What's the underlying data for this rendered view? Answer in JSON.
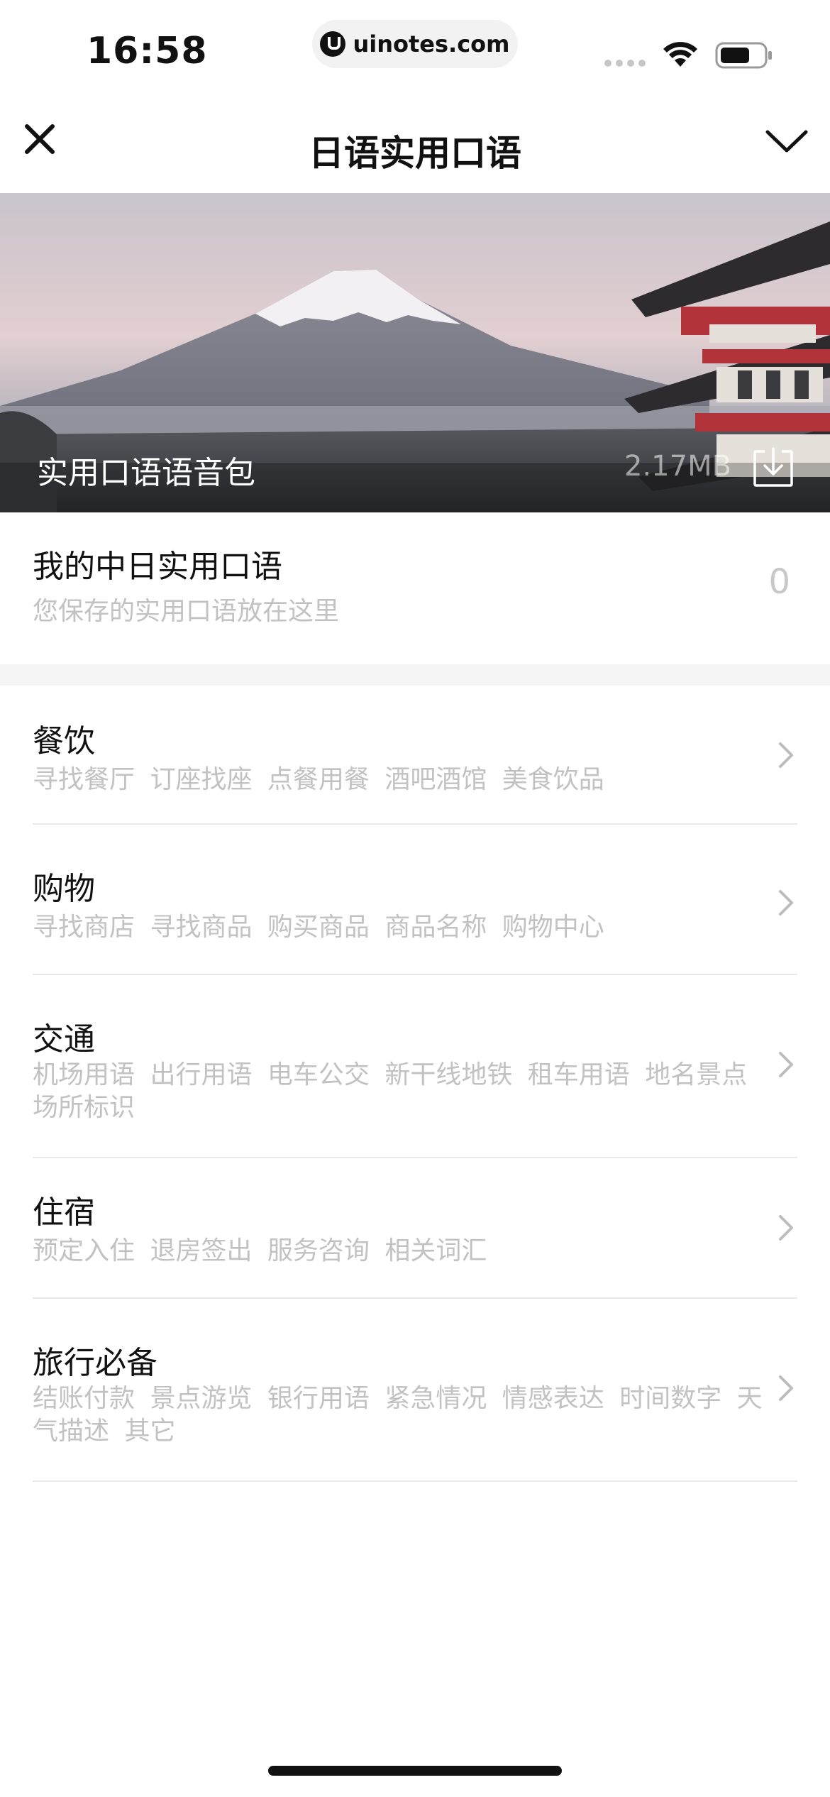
{
  "status_bar": {
    "time": "16:58",
    "url": "uinotes.com",
    "icons": [
      "signal-dots-icon",
      "wifi-icon",
      "battery-icon"
    ]
  },
  "nav": {
    "title": "日语实用口语",
    "left_icon": "close-icon",
    "right_icon": "chevron-down-icon"
  },
  "hero": {
    "label": "实用口语语音包",
    "size": "2.17MB",
    "icon": "download-icon"
  },
  "saved": {
    "title": "我的中日实用口语",
    "subtitle": "您保存的实用口语放在这里",
    "count": "0"
  },
  "categories": [
    {
      "title": "餐饮",
      "desc": "寻找餐厅 订座找座 点餐用餐 酒吧酒馆 美食饮品"
    },
    {
      "title": "购物",
      "desc": "寻找商店 寻找商品 购买商品 商品名称 购物中心"
    },
    {
      "title": "交通",
      "desc": "机场用语 出行用语 电车公交 新干线地铁 租车用语 地名景点 场所标识"
    },
    {
      "title": "住宿",
      "desc": "预定入住 退房签出 服务咨询 相关词汇"
    },
    {
      "title": "旅行必备",
      "desc": "结账付款 景点游览 银行用语 紧急情况 情感表达 时间数字 天气描述 其它"
    }
  ]
}
